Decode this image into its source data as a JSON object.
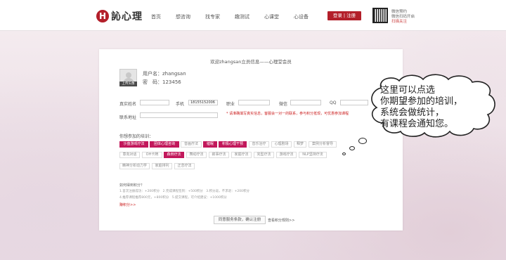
{
  "header": {
    "logo_letter": "H",
    "logo_text": "訫心理",
    "nav": [
      "首页",
      "想咨询",
      "找专家",
      "趣测试",
      "心课堂",
      "心设备"
    ],
    "login": "登录 | 注册",
    "qr_text_line1": "微信预约",
    "qr_text_line2": "微信扫码开启",
    "qr_text_line3": "扫描关注"
  },
  "panel": {
    "title": "欢迎zhangsan立员信息——心理堂会员",
    "avatar_button": "上传头像",
    "username_line": "用户名：zhangsan",
    "password_line": "密　码：123456",
    "fields": {
      "realname_label": "真实姓名",
      "phone_label": "手机",
      "phone_value": "18155152006",
      "job_label": "职业",
      "wechat_label": "微信",
      "qq_label": "QQ",
      "address_label": "联系地址"
    },
    "hint": "* 请准确填写真实信息，客服会一对一的联系，参与积分抵现，可优惠参加课程",
    "training_label": "你想参加的培训：",
    "tags_row1": [
      {
        "label": "沙盘游戏疗法",
        "on": true
      },
      {
        "label": "团体心理咨询",
        "on": true
      },
      {
        "label": "音画疗法",
        "on": false
      },
      {
        "label": "催眠",
        "on": true
      },
      {
        "label": "积极心理干预",
        "on": true
      },
      {
        "label": "音乐治疗",
        "on": false
      },
      {
        "label": "心理剧场",
        "on": false
      },
      {
        "label": "释梦",
        "on": false
      },
      {
        "label": "案例分析督导",
        "on": false
      }
    ],
    "tags_row2": [
      {
        "label": "意向对话",
        "on": false
      },
      {
        "label": "OH卡牌",
        "on": false
      },
      {
        "label": "森田疗法",
        "on": true
      },
      {
        "label": "舞动疗法",
        "on": false
      },
      {
        "label": "叙事疗法",
        "on": false
      },
      {
        "label": "家庭疗法",
        "on": false
      },
      {
        "label": "完型疗法",
        "on": false
      },
      {
        "label": "游戏疗法",
        "on": false
      },
      {
        "label": "NLP坚持疗法",
        "on": false
      }
    ],
    "tags_row3": [
      {
        "label": "精神分析动力学",
        "on": false
      },
      {
        "label": "家庭排列",
        "on": false
      },
      {
        "label": "正念疗法",
        "on": false
      }
    ],
    "points_title": "如何得到积分？",
    "points_line1": "1.首次注册成功：+200积分　2.完成课程签到：+500积分　3.积分返，不求退：+200积分",
    "points_line2": "4.推荐课程推荐800元，+800积分　5.提交课程，可介绍建议：+1000积分",
    "earn_link": "赚积分>>",
    "submit": "同意服务条款，确认注册",
    "rules_link": "查看积分规则>>"
  },
  "bubble": {
    "text": "这里可以点选\n你期望参加的培训，\n系统会做统计，\n有课程会通知您。"
  }
}
